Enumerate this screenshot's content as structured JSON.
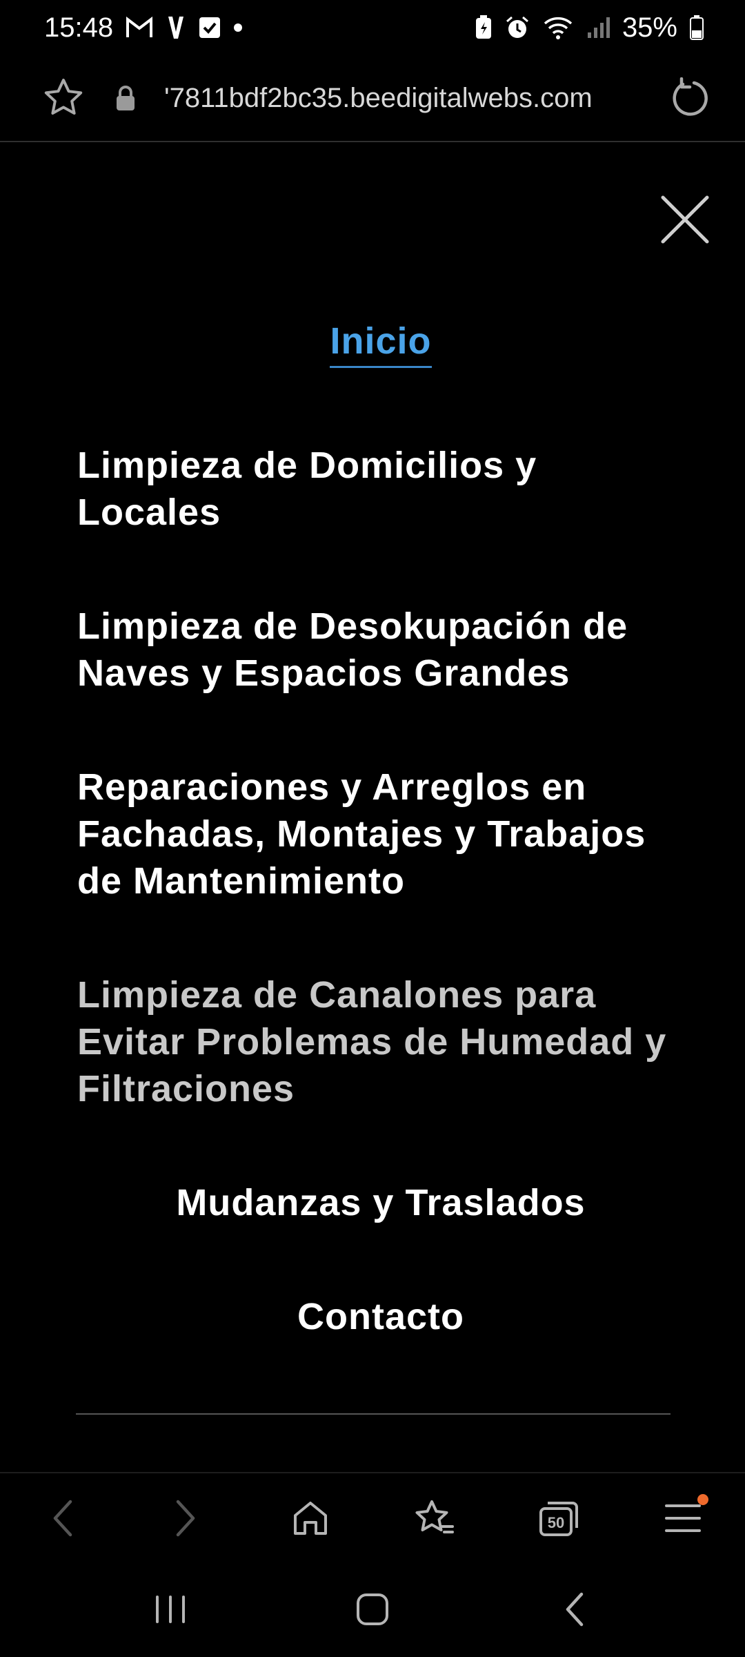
{
  "status_bar": {
    "time": "15:48",
    "battery": "35%"
  },
  "browser": {
    "url": "'7811bdf2bc35.beedigitalwebs.com",
    "tabs_count": "50"
  },
  "menu": {
    "items": [
      {
        "label": "Inicio"
      },
      {
        "label": "Limpieza de Domicilios y Locales"
      },
      {
        "label": "Limpieza de Desokupación de Naves y Espacios Grandes"
      },
      {
        "label": "Reparaciones y Arreglos en Fachadas, Montajes y Trabajos de Mantenimiento"
      },
      {
        "label": "Limpieza de Canalones para Evitar Problemas de Humedad y Filtraciones"
      },
      {
        "label": "Mudanzas y Traslados"
      },
      {
        "label": "Contacto"
      }
    ]
  },
  "colors": {
    "accent": "#4aa3e8",
    "background": "#000000",
    "notification": "#ef6a2c"
  },
  "icons": {
    "close": "close-icon",
    "star": "star-icon",
    "lock": "lock-icon",
    "reload": "reload-icon"
  }
}
